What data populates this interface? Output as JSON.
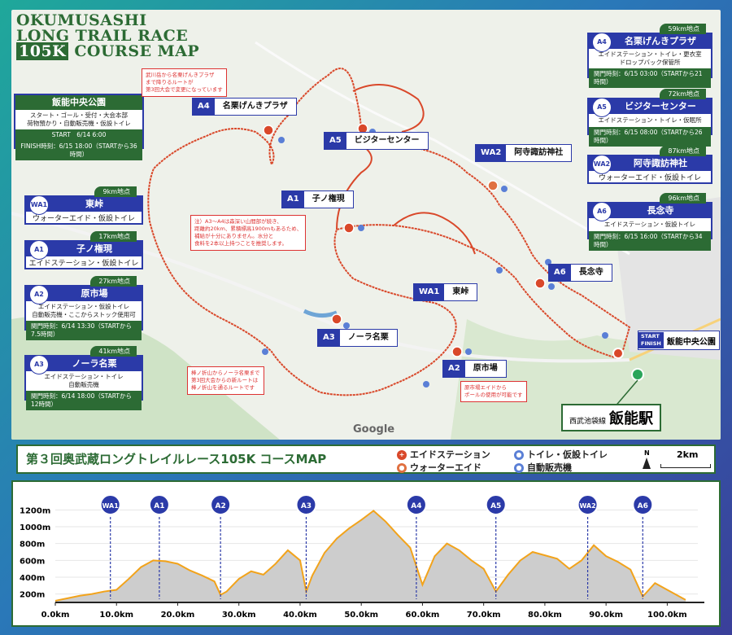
{
  "title": {
    "line1": "OKUMUSASHI",
    "line2": "LONG TRAIL RACE",
    "line3_hl": "105K",
    "line3_rest": "COURSE MAP"
  },
  "start_box": {
    "title": "飯能中央公園",
    "line1": "スタート・ゴール・受付・大会本部",
    "line2": "荷物預かり・自動販売機・仮設トイレ",
    "start": "START　6/14 6:00",
    "finish": "FINISH時刻：6/15 18:00（STARTから36時間）"
  },
  "left_boxes": [
    {
      "code": "WA1",
      "name": "東峠",
      "km": "9km地点",
      "desc": "ウォーターエイド・仮設トイレ",
      "time": ""
    },
    {
      "code": "A1",
      "name": "子ノ権現",
      "km": "17km地点",
      "desc": "エイドステーション・仮設トイレ",
      "time": ""
    },
    {
      "code": "A2",
      "name": "原市場",
      "km": "27km地点",
      "desc": "エイドステーション・仮設トイレ\n自動販売機・ここからストック使用可",
      "time": "関門時刻：6/14 13:30（STARTから7.5時間）"
    },
    {
      "code": "A3",
      "name": "ノーラ名栗",
      "km": "41km地点",
      "desc": "エイドステーション・トイレ\n自動販売機",
      "time": "関門時刻：6/14 18:00（STARTから12時間）"
    }
  ],
  "right_boxes": [
    {
      "code": "A4",
      "name": "名栗げんきプラザ",
      "km": "59km地点",
      "desc": "エイドステーション・トイレ・更衣室\nドロップバック保管所",
      "time": "関門時刻：6/15 03:00（STARTから21時間）"
    },
    {
      "code": "A5",
      "name": "ビジターセンター",
      "km": "72km地点",
      "desc": "エイドステーション・トイレ・仮眠所",
      "time": "関門時刻：6/15 08:00（STARTから26時間）"
    },
    {
      "code": "WA2",
      "name": "阿寺諏訪神社",
      "km": "87km地点",
      "desc": "ウォーターエイド・仮設トイレ",
      "time": ""
    },
    {
      "code": "A6",
      "name": "長念寺",
      "km": "96km地点",
      "desc": "エイドステーション・仮設トイレ",
      "time": "関門時刻：6/15 16:00（STARTから34時間）"
    }
  ],
  "map_labels": [
    {
      "code": "A4",
      "name": "名栗げんきプラザ"
    },
    {
      "code": "A5",
      "name": "ビジターセンター"
    },
    {
      "code": "WA2",
      "name": "阿寺諏訪神社"
    },
    {
      "code": "A1",
      "name": "子ノ権現"
    },
    {
      "code": "A6",
      "name": "長念寺"
    },
    {
      "code": "WA1",
      "name": "東峠"
    },
    {
      "code": "A3",
      "name": "ノーラ名栗"
    },
    {
      "code": "A2",
      "name": "原市場"
    }
  ],
  "notes": [
    "武川岳から名栗げんきプラザ\nまで降りるルートが\n第3回大会で変更になっています",
    "注）A3～A4は森深い山間部が続き、\n距離約20km、累積標高1900mもあるため、\n補給が十分にありません。水分と\n食料を2本以上持つことを推奨します。",
    "棒ノ折山からノーラ名栗まで\n第3回大会からの新ルートは\n棒ノ折山を通るルートです",
    "原市場エイドから\nポールの使用が可能です"
  ],
  "start_marker": {
    "start": "START",
    "finish": "FINISH",
    "name": "飯能中央公園"
  },
  "station_box": {
    "line": "西武池袋線",
    "name": "飯能駅"
  },
  "google": "Google",
  "legend": {
    "title": "第３回奥武蔵ロングトレイルレース105K コースMAP",
    "items": [
      "エイドステーション",
      "ウォーターエイド",
      "トイレ・仮設トイレ",
      "自動販売機"
    ],
    "scale": "2km",
    "north": "N"
  },
  "elevation": {
    "y_ticks": [
      "1200m",
      "1000m",
      "800m",
      "600m",
      "400m",
      "200m"
    ],
    "x_ticks": [
      "0.0km",
      "10.0km",
      "20.0km",
      "30.0km",
      "40.0km",
      "50.0km",
      "60.0km",
      "70.0km",
      "80.0km",
      "90.0km",
      "100.0km"
    ],
    "stations": [
      {
        "code": "WA1",
        "km": 9
      },
      {
        "code": "A1",
        "km": 17
      },
      {
        "code": "A2",
        "km": 27
      },
      {
        "code": "A3",
        "km": 41
      },
      {
        "code": "A4",
        "km": 59
      },
      {
        "code": "A5",
        "km": 72
      },
      {
        "code": "WA2",
        "km": 87
      },
      {
        "code": "A6",
        "km": 96
      }
    ],
    "profile_km": [
      0,
      2,
      4,
      6,
      8,
      10,
      12,
      14,
      16,
      18,
      20,
      22,
      24,
      26,
      27,
      28,
      30,
      32,
      34,
      36,
      38,
      40,
      41,
      42,
      44,
      46,
      48,
      50,
      52,
      54,
      56,
      58,
      60,
      62,
      64,
      66,
      68,
      70,
      72,
      74,
      76,
      78,
      80,
      82,
      84,
      86,
      88,
      90,
      92,
      94,
      96,
      98,
      100,
      103
    ],
    "profile_m": [
      120,
      150,
      180,
      200,
      230,
      250,
      380,
      520,
      600,
      590,
      560,
      480,
      420,
      350,
      190,
      230,
      380,
      470,
      430,
      560,
      720,
      600,
      230,
      420,
      690,
      860,
      980,
      1080,
      1190,
      1060,
      900,
      750,
      310,
      650,
      800,
      720,
      600,
      500,
      230,
      430,
      600,
      700,
      660,
      620,
      500,
      600,
      780,
      650,
      580,
      490,
      170,
      330,
      250,
      130
    ]
  }
}
